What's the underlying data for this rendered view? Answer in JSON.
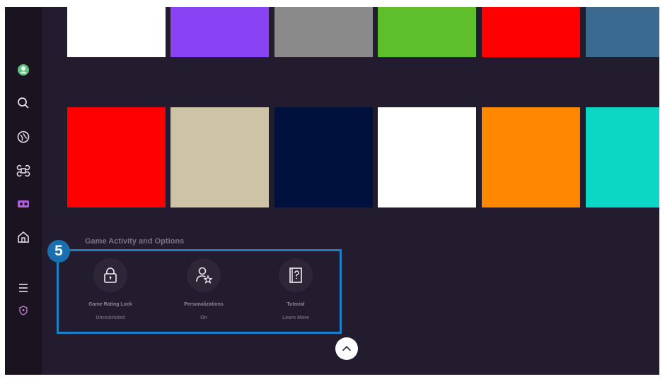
{
  "sidebar": {
    "items": [
      {
        "icon": "profile-icon",
        "color": "#5ec47c"
      },
      {
        "icon": "search-icon"
      },
      {
        "icon": "ambient-icon"
      },
      {
        "icon": "apps-icon"
      },
      {
        "icon": "game-icon",
        "active": true,
        "color": "#b35fe0"
      },
      {
        "icon": "home-icon"
      },
      {
        "icon": "menu-icon"
      },
      {
        "icon": "privacy-shield-icon"
      }
    ]
  },
  "grid": {
    "row1_colors": [
      "#ffffff",
      "#8a42f5",
      "#8a8a8a",
      "#5ebf2d",
      "#ff0000",
      "#3a6a90"
    ],
    "row2_colors": [
      "#ff0000",
      "#cdc4a8",
      "#00113d",
      "#ffffff",
      "#ff8800",
      "#0cd6c4"
    ]
  },
  "section": {
    "title": "Game Activity and Options",
    "badge": "5",
    "border_color": "#1b80c4",
    "options": [
      {
        "icon": "lock-icon",
        "label": "Game Rating Lock",
        "value": "Unrestricted"
      },
      {
        "icon": "person-star-icon",
        "label": "Personalizations",
        "value": "On"
      },
      {
        "icon": "tutorial-book-icon",
        "label": "Tutorial",
        "value": "Learn More"
      }
    ]
  },
  "scroll_button": {
    "icon": "chevron-up-icon"
  }
}
